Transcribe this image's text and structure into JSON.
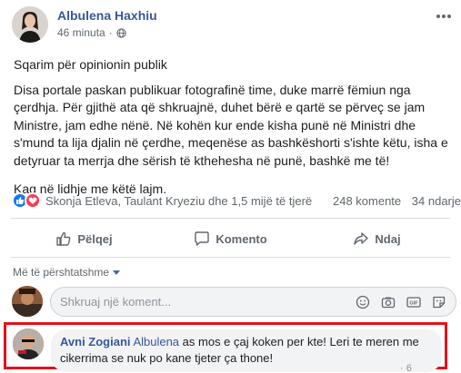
{
  "post": {
    "author": "Albulena Haxhiu",
    "time": "46 minuta",
    "paragraphs": [
      "Sqarim për opinionin publik",
      "Disa portale paskan publikuar fotografinë time, duke marrë fëmiun nga çerdhja. Për gjithë ata që shkruajnë, duhet bërë e qartë se përveç se jam Ministre, jam edhe nënë. Në kohën kur ende kisha punë në Ministri dhe s'mund ta lija djalin në çerdhe, meqenëse as bashkëshorti s'ishte këtu, isha e detyruar ta merrja dhe sërish të kthehesha në punë, bashkë me të!",
      "Kaq në lidhje me këtë lajm."
    ]
  },
  "reactions": {
    "names": "Skonja Etleva, Taulant Kryeziu dhe 1,5 mijë të tjerë",
    "comments": "248 komente",
    "shares": "34 ndarje"
  },
  "actions": {
    "like": "Pëlqej",
    "comment": "Komento",
    "share": "Ndaj"
  },
  "filter": {
    "label": "Më të përshtatshme"
  },
  "composer": {
    "placeholder": "Shkruaj një koment..."
  },
  "comment": {
    "author": "Avni Zogiani",
    "tag": "Albulena",
    "text": "as mos e çaj koken per kte! Leri te meren me cikerrima se nuk po kane tjeter ça thone!",
    "footer": "· 6"
  },
  "colors": {
    "link": "#385898",
    "highlight": "#e3111b",
    "like": "#1877f2",
    "love": "#f33e58"
  }
}
